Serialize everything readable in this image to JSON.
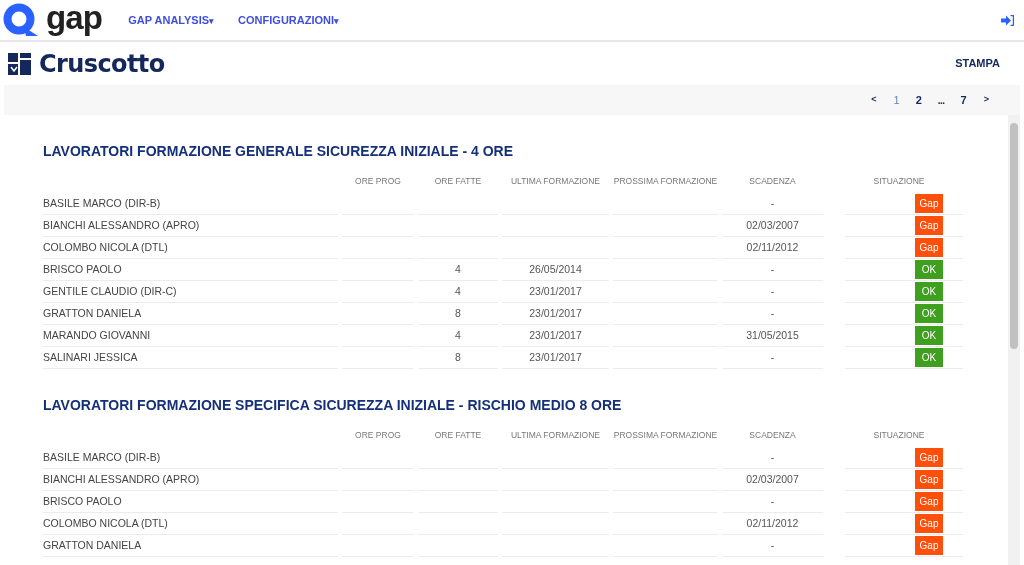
{
  "header": {
    "logo_text": "gap",
    "menu": [
      {
        "label": "GAP ANALYSIS",
        "caret": "▾"
      },
      {
        "label": "CONFIGURAZIONI",
        "caret": "▾"
      }
    ]
  },
  "page": {
    "title": "Cruscotto",
    "print_link": "STAMPA"
  },
  "pagination": [
    {
      "label": "<",
      "kind": "nav",
      "selected": false
    },
    {
      "label": "1",
      "kind": "page",
      "selected": true
    },
    {
      "label": "2",
      "kind": "page",
      "selected": false
    },
    {
      "label": "...",
      "kind": "gap",
      "selected": false
    },
    {
      "label": "7",
      "kind": "page",
      "selected": false
    },
    {
      "label": ">",
      "kind": "nav",
      "selected": false
    }
  ],
  "sections": [
    {
      "title": "LAVORATORI FORMAZIONE GENERALE SICUREZZA INIZIALE - 4 ORE",
      "columns": [
        "ORE PROG",
        "ORE FATTE",
        "ULTIMA FORMAZIONE",
        "PROSSIMA FORMAZIONE",
        "SCADENZA",
        "SITUAZIONE"
      ],
      "rows": [
        {
          "name": "BASILE MARCO (DIR-B)",
          "scadenza": "-",
          "situazione": {
            "label": "Gap",
            "kind": "gap"
          }
        },
        {
          "name": "BIANCHI ALESSANDRO (APRO)",
          "scadenza": "02/03/2007",
          "situazione": {
            "label": "Gap",
            "kind": "gap"
          }
        },
        {
          "name": "COLOMBO NICOLA (DTL)",
          "scadenza": "02/11/2012",
          "situazione": {
            "label": "Gap",
            "kind": "gap"
          }
        },
        {
          "name": "BRISCO PAOLO",
          "ore_fatte": "4",
          "ultima_formazione": "26/05/2014",
          "scadenza": "-",
          "situazione": {
            "label": "OK",
            "kind": "ok"
          }
        },
        {
          "name": "GENTILE CLAUDIO (DIR-C)",
          "ore_fatte": "4",
          "ultima_formazione": "23/01/2017",
          "scadenza": "-",
          "situazione": {
            "label": "OK",
            "kind": "ok"
          }
        },
        {
          "name": "GRATTON DANIELA",
          "ore_fatte": "8",
          "ultima_formazione": "23/01/2017",
          "scadenza": "-",
          "situazione": {
            "label": "OK",
            "kind": "ok"
          }
        },
        {
          "name": "MARANDO GIOVANNI",
          "ore_fatte": "4",
          "ultima_formazione": "23/01/2017",
          "scadenza": "31/05/2015",
          "situazione": {
            "label": "OK",
            "kind": "ok"
          }
        },
        {
          "name": "SALINARI JESSICA",
          "ore_fatte": "8",
          "ultima_formazione": "23/01/2017",
          "scadenza": "-",
          "situazione": {
            "label": "OK",
            "kind": "ok"
          }
        }
      ]
    },
    {
      "title": "LAVORATORI FORMAZIONE SPECIFICA SICUREZZA INIZIALE - RISCHIO MEDIO 8 ORE",
      "columns": [
        "ORE PROG",
        "ORE FATTE",
        "ULTIMA FORMAZIONE",
        "PROSSIMA FORMAZIONE",
        "SCADENZA",
        "SITUAZIONE"
      ],
      "rows": [
        {
          "name": "BASILE MARCO (DIR-B)",
          "scadenza": "-",
          "situazione": {
            "label": "Gap",
            "kind": "gap"
          }
        },
        {
          "name": "BIANCHI ALESSANDRO (APRO)",
          "scadenza": "02/03/2007",
          "situazione": {
            "label": "Gap",
            "kind": "gap"
          }
        },
        {
          "name": "BRISCO PAOLO",
          "scadenza": "-",
          "situazione": {
            "label": "Gap",
            "kind": "gap"
          }
        },
        {
          "name": "COLOMBO NICOLA (DTL)",
          "scadenza": "02/11/2012",
          "situazione": {
            "label": "Gap",
            "kind": "gap"
          }
        },
        {
          "name": "GRATTON DANIELA",
          "scadenza": "-",
          "situazione": {
            "label": "Gap",
            "kind": "gap"
          }
        }
      ]
    }
  ]
}
